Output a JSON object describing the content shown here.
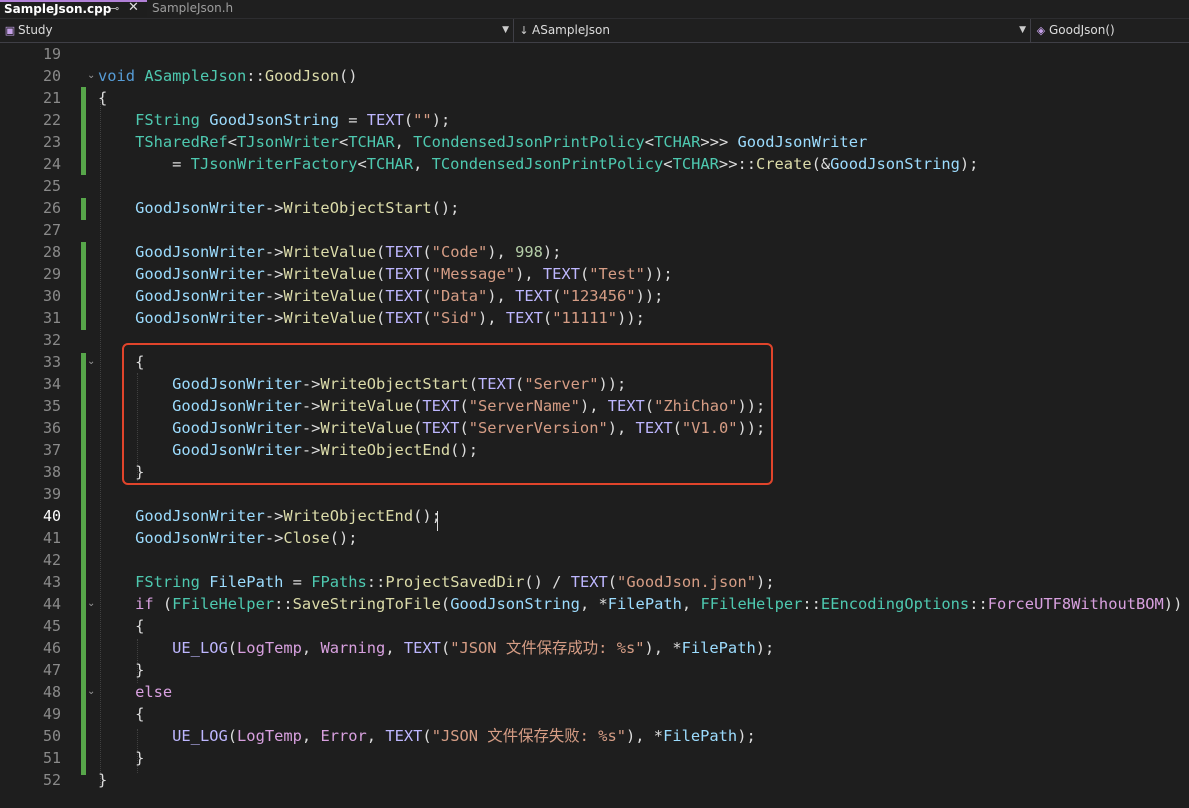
{
  "tabs": [
    {
      "label": "SampleJson.cpp",
      "active": true
    },
    {
      "label": "SampleJson.h",
      "active": false
    }
  ],
  "icons": {
    "pin": "pin-icon",
    "close": "close-icon",
    "project": "project-icon",
    "class": "class-icon",
    "method": "method-icon",
    "dropdown": "chevron-down-icon"
  },
  "navbar": {
    "project": "Study",
    "class": "ASampleJson",
    "method": "GoodJson()"
  },
  "editor": {
    "current_line": 40,
    "line_numbers": [
      "19",
      "20",
      "21",
      "22",
      "23",
      "24",
      "25",
      "26",
      "27",
      "28",
      "29",
      "30",
      "31",
      "32",
      "33",
      "34",
      "35",
      "36",
      "37",
      "38",
      "39",
      "40",
      "41",
      "42",
      "43",
      "44",
      "45",
      "46",
      "47",
      "48",
      "49",
      "50",
      "51",
      "52"
    ],
    "lines": [
      "",
      "void ASampleJson::GoodJson()",
      "{",
      "    FString GoodJsonString = TEXT(\"\");",
      "    TSharedRef<TJsonWriter<TCHAR, TCondensedJsonPrintPolicy<TCHAR>>> GoodJsonWriter",
      "        = TJsonWriterFactory<TCHAR, TCondensedJsonPrintPolicy<TCHAR>>::Create(&GoodJsonString);",
      "",
      "    GoodJsonWriter->WriteObjectStart();",
      "",
      "    GoodJsonWriter->WriteValue(TEXT(\"Code\"), 998);",
      "    GoodJsonWriter->WriteValue(TEXT(\"Message\"), TEXT(\"Test\"));",
      "    GoodJsonWriter->WriteValue(TEXT(\"Data\"), TEXT(\"123456\"));",
      "    GoodJsonWriter->WriteValue(TEXT(\"Sid\"), TEXT(\"11111\"));",
      "",
      "    {",
      "        GoodJsonWriter->WriteObjectStart(TEXT(\"Server\"));",
      "        GoodJsonWriter->WriteValue(TEXT(\"ServerName\"), TEXT(\"ZhiChao\"));",
      "        GoodJsonWriter->WriteValue(TEXT(\"ServerVersion\"), TEXT(\"V1.0\"));",
      "        GoodJsonWriter->WriteObjectEnd();",
      "    }",
      "",
      "    GoodJsonWriter->WriteObjectEnd();",
      "    GoodJsonWriter->Close();",
      "",
      "    FString FilePath = FPaths::ProjectSavedDir() / TEXT(\"GoodJson.json\");",
      "    if (FFileHelper::SaveStringToFile(GoodJsonString, *FilePath, FFileHelper::EEncodingOptions::ForceUTF8WithoutBOM))",
      "    {",
      "        UE_LOG(LogTemp, Warning, TEXT(\"JSON 文件保存成功: %s\"), *FilePath);",
      "    }",
      "    else",
      "    {",
      "        UE_LOG(LogTemp, Error, TEXT(\"JSON 文件保存失败: %s\"), *FilePath);",
      "    }",
      "}"
    ]
  }
}
